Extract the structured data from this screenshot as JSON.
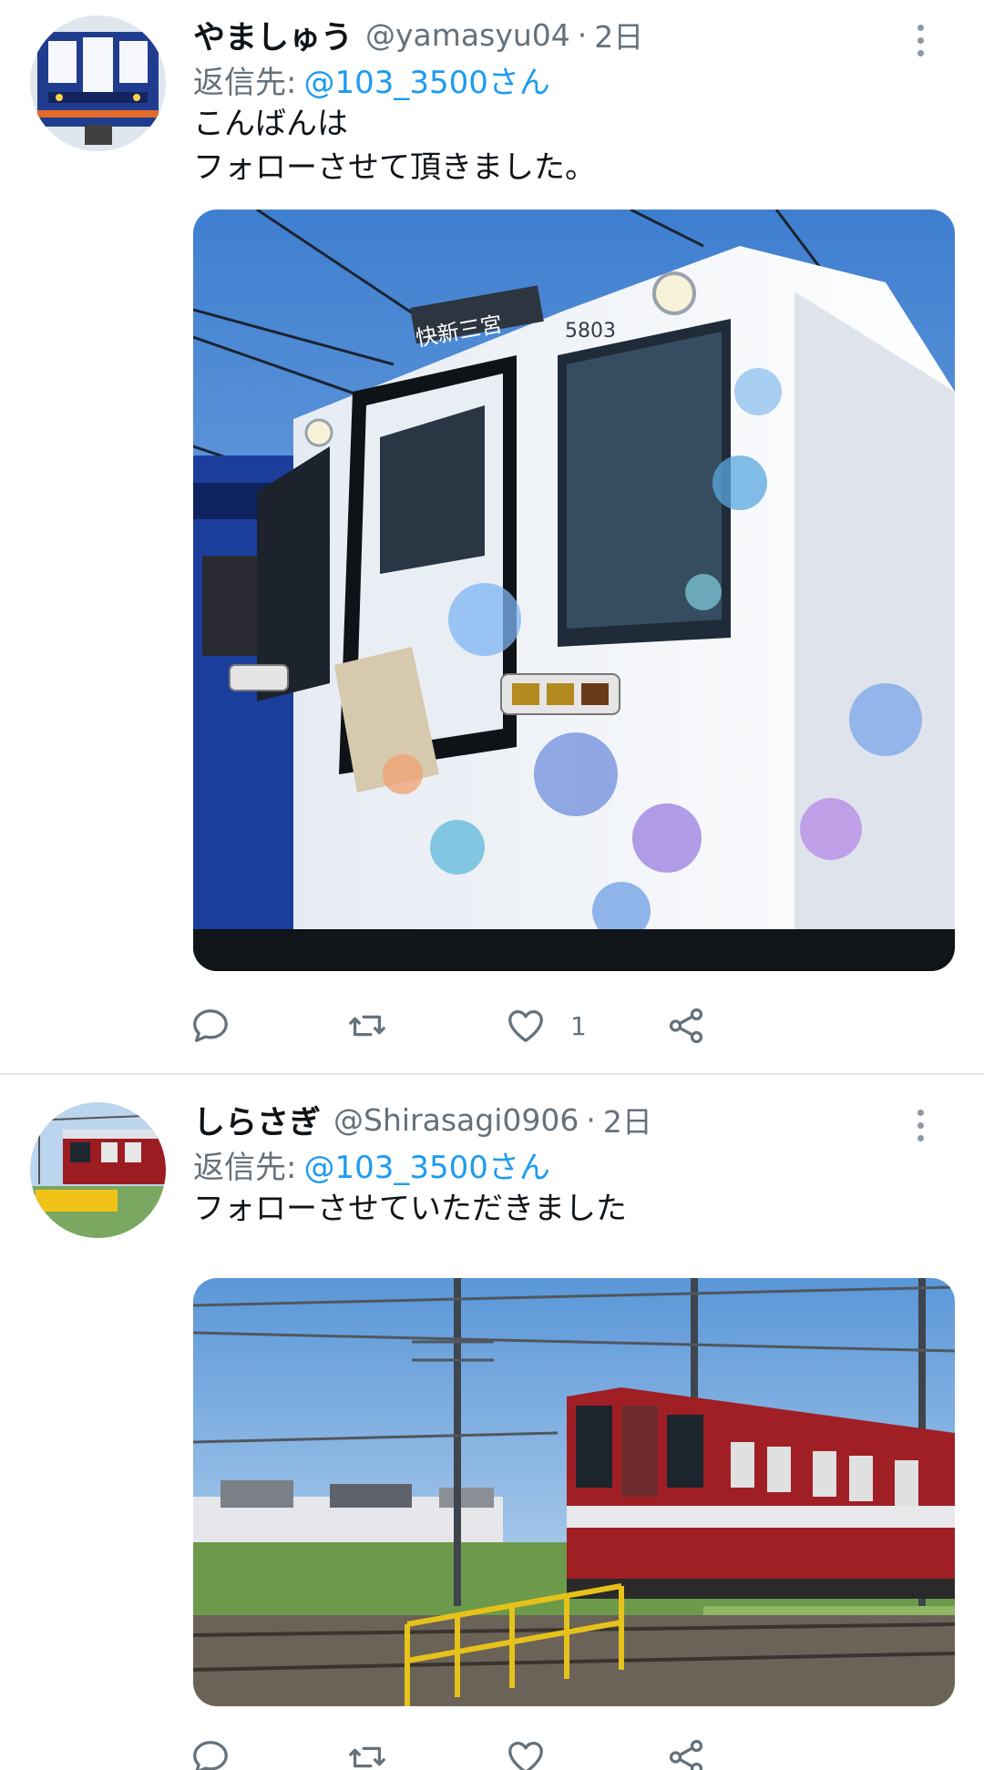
{
  "tweets": [
    {
      "author_name": "やましゅう",
      "handle": "@yamasyu04",
      "separator": "·",
      "time": "2日",
      "reply_label": "返信先:",
      "reply_to": "@103_3500さん",
      "text": "こんばんは\nフォローさせて頂きました。",
      "image_signs": {
        "destination": "快新三宮",
        "car_number": "5803"
      },
      "actions": {
        "reply_icon": "reply-icon",
        "retweet_icon": "retweet-icon",
        "like_icon": "heart-icon",
        "like_count": "1",
        "share_icon": "share-icon"
      }
    },
    {
      "author_name": "しらさぎ",
      "handle": "@Shirasagi0906",
      "separator": "·",
      "time": "2日",
      "reply_label": "返信先:",
      "reply_to": "@103_3500さん",
      "text": "フォローさせていただきました",
      "actions": {
        "reply_icon": "reply-icon",
        "retweet_icon": "retweet-icon",
        "like_icon": "heart-icon",
        "like_count": "",
        "share_icon": "share-icon"
      }
    }
  ],
  "colors": {
    "link": "#1d9bf0",
    "secondary_text": "#65717b",
    "divider": "#e4e6e8",
    "icon": "#65717b"
  }
}
